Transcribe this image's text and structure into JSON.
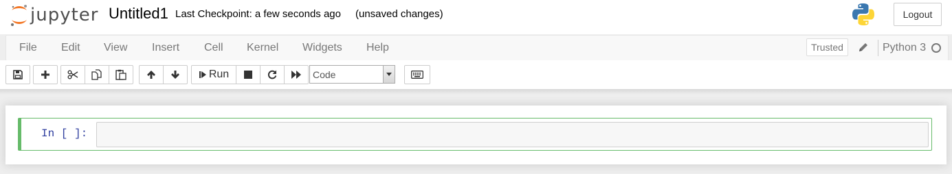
{
  "header": {
    "logo_text": "jupyter",
    "notebook_name": "Untitled1",
    "checkpoint": "Last Checkpoint: a few seconds ago",
    "autosave_status": "(unsaved changes)",
    "logout_label": "Logout"
  },
  "menubar": {
    "items": [
      "File",
      "Edit",
      "View",
      "Insert",
      "Cell",
      "Kernel",
      "Widgets",
      "Help"
    ],
    "trusted_label": "Trusted",
    "kernel_name": "Python 3",
    "kernel_status": "idle"
  },
  "toolbar": {
    "buttons": {
      "save": "save-icon",
      "insert_below": "plus-icon",
      "cut": "scissors-icon",
      "copy": "copy-icon",
      "paste": "paste-icon",
      "move_up": "arrow-up-icon",
      "move_down": "arrow-down-icon",
      "interrupt": "stop-icon",
      "restart": "restart-icon",
      "restart_run_all": "fast-forward-icon",
      "command_palette": "keyboard-icon"
    },
    "run_label": "Run",
    "cell_type": "Code"
  },
  "notebook": {
    "cells": [
      {
        "prompt": "In [ ]:",
        "source": ""
      }
    ]
  },
  "colors": {
    "cell_selected_border": "#66bb6a",
    "prompt": "#303f9f",
    "logo_orange": "#f37726",
    "menu_text": "#777777"
  }
}
